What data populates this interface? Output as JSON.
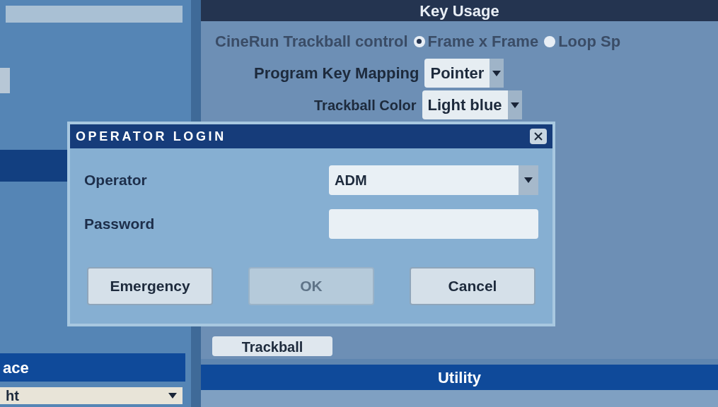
{
  "key_usage": {
    "title": "Key Usage",
    "cinerun": {
      "label": "CineRun Trackball control",
      "options": [
        {
          "label": "Frame x Frame",
          "selected": true
        },
        {
          "label": "Loop Sp",
          "selected": false
        }
      ]
    },
    "program_key_mapping": {
      "label": "Program Key Mapping",
      "value": "Pointer"
    },
    "trackball_color": {
      "label": "Trackball Color",
      "value": "Light blue"
    },
    "trackball_button": "Trackball"
  },
  "utility": {
    "title": "Utility"
  },
  "left_panel": {
    "header": "ace",
    "dropdown_value": "ht"
  },
  "dialog": {
    "title": "OPERATOR LOGIN",
    "fields": [
      {
        "kind": "select",
        "label": "Operator",
        "value": "ADM"
      },
      {
        "kind": "text",
        "label": "Password"
      }
    ],
    "buttons": [
      {
        "label": "Emergency",
        "disabled": false
      },
      {
        "label": "OK",
        "disabled": true
      },
      {
        "label": "Cancel",
        "disabled": false
      }
    ]
  }
}
